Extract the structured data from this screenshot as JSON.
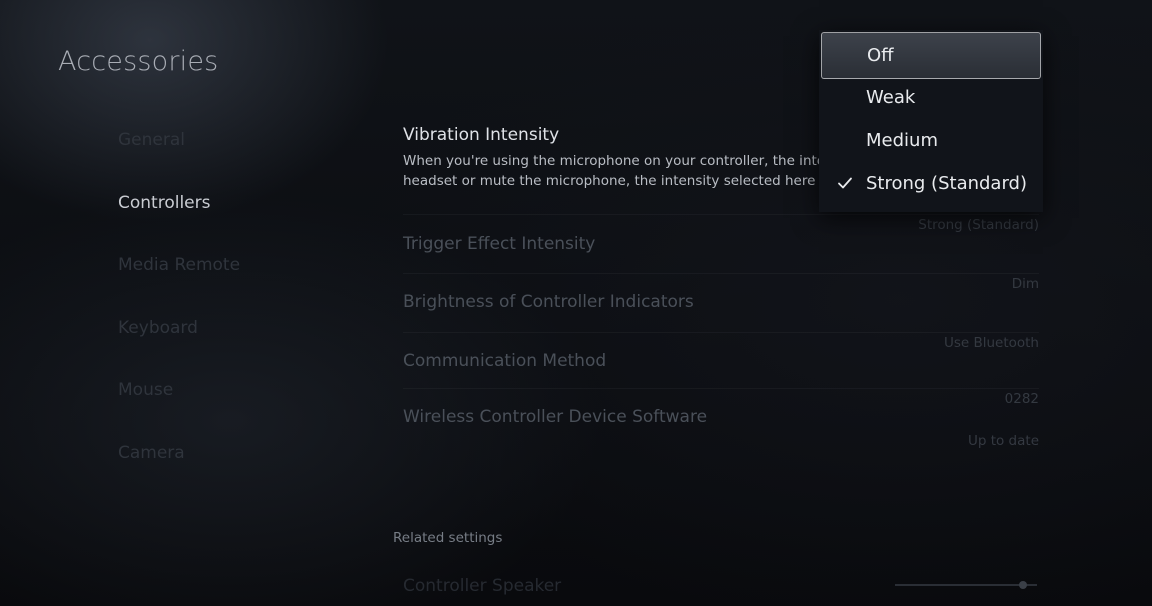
{
  "page": {
    "title": "Accessories"
  },
  "sidebar": {
    "items": [
      {
        "label": "General",
        "active": false
      },
      {
        "label": "Controllers",
        "active": true
      },
      {
        "label": "Media Remote",
        "active": false
      },
      {
        "label": "Keyboard",
        "active": false
      },
      {
        "label": "Mouse",
        "active": false
      },
      {
        "label": "Camera",
        "active": false
      }
    ]
  },
  "settings": {
    "vibration": {
      "label": "Vibration Intensity",
      "desc_line1": "When you're using the microphone on your controller, the intens",
      "desc_line2": "headset or mute the microphone, the intensity selected here wil"
    },
    "trigger": {
      "label": "Trigger Effect Intensity",
      "value": "Strong (Standard)"
    },
    "brightness": {
      "label": "Brightness of Controller Indicators",
      "value": "Dim"
    },
    "communication": {
      "label": "Communication Method",
      "value": "Use Bluetooth"
    },
    "software": {
      "label": "Wireless Controller Device Software",
      "version": "0282",
      "status": "Up to date"
    }
  },
  "related": {
    "heading": "Related settings",
    "item": "Controller Speaker"
  },
  "dropdown": {
    "options": [
      {
        "label": "Off",
        "highlighted": true,
        "checked": false
      },
      {
        "label": "Weak",
        "highlighted": false,
        "checked": false
      },
      {
        "label": "Medium",
        "highlighted": false,
        "checked": false
      },
      {
        "label": "Strong (Standard)",
        "highlighted": false,
        "checked": true
      }
    ],
    "check_icon": "checkmark-icon"
  },
  "colors": {
    "highlight_border": "#ffffff",
    "text_primary": "#e9ebee",
    "background": "#0c0e12"
  }
}
